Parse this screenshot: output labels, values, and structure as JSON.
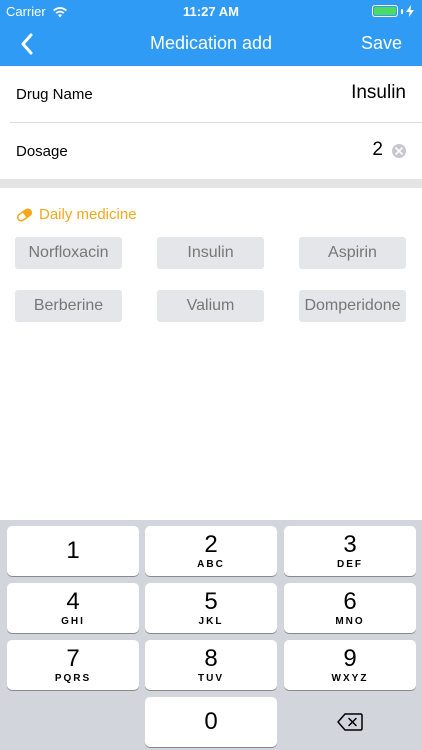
{
  "status_bar": {
    "carrier": "Carrier",
    "time": "11:27 AM"
  },
  "nav": {
    "title": "Medication add",
    "save_label": "Save"
  },
  "form": {
    "drug_name_label": "Drug Name",
    "drug_name_value": "Insulin",
    "dosage_label": "Dosage",
    "dosage_value": "2"
  },
  "daily_medicine": {
    "title": "Daily medicine",
    "items": [
      "Norfloxacin",
      "Insulin",
      "Aspirin",
      "Berberine",
      "Valium",
      "Domperidone"
    ]
  },
  "keypad": {
    "keys": [
      {
        "num": "1",
        "letters": ""
      },
      {
        "num": "2",
        "letters": "ABC"
      },
      {
        "num": "3",
        "letters": "DEF"
      },
      {
        "num": "4",
        "letters": "GHI"
      },
      {
        "num": "5",
        "letters": "JKL"
      },
      {
        "num": "6",
        "letters": "MNO"
      },
      {
        "num": "7",
        "letters": "PQRS"
      },
      {
        "num": "8",
        "letters": "TUV"
      },
      {
        "num": "9",
        "letters": "WXYZ"
      }
    ],
    "zero": "0"
  },
  "colors": {
    "accent": "#2f9bf5",
    "section_title": "#f3a81b",
    "battery": "#4cd964"
  }
}
